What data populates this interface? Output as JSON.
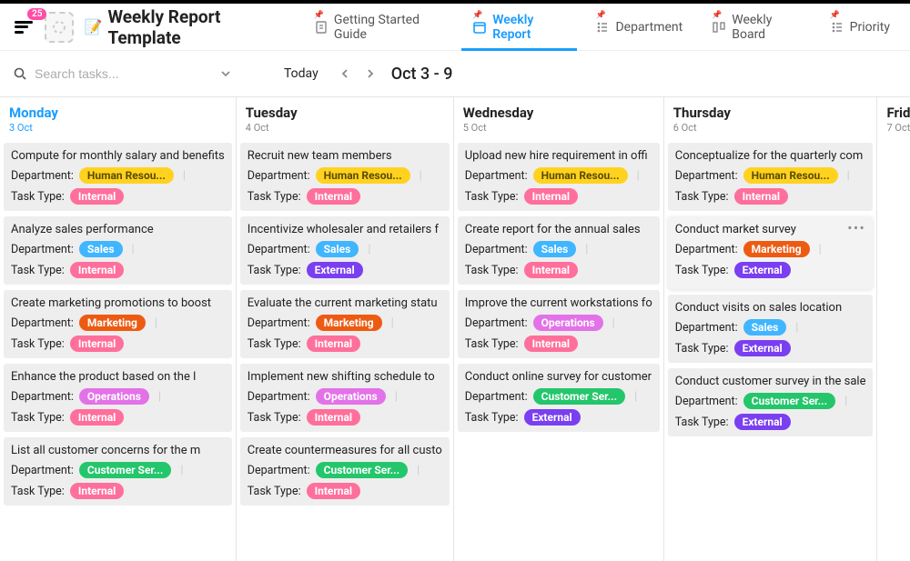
{
  "header": {
    "notification_count": "25",
    "page_emoji": "📝",
    "page_title": "Weekly Report Template"
  },
  "tabs": [
    {
      "label": "Getting Started Guide",
      "active": false
    },
    {
      "label": "Weekly Report",
      "active": true
    },
    {
      "label": "Department",
      "active": false
    },
    {
      "label": "Weekly Board",
      "active": false
    },
    {
      "label": "Priority",
      "active": false
    }
  ],
  "toolbar": {
    "search_placeholder": "Search tasks...",
    "today_label": "Today",
    "date_range": "Oct 3 - 9"
  },
  "field_labels": {
    "department": "Department:",
    "task_type": "Task Type:"
  },
  "tag_colors": {
    "Human Resou...": "#ffd21f",
    "Sales": "#3fb6ff",
    "Marketing": "#ed5b13",
    "Operations": "#e372e8",
    "Customer Ser...": "#24c66b",
    "Internal": "#ff6f9c",
    "External": "#7a3ff0"
  },
  "columns": [
    {
      "day": "Monday",
      "date": "3 Oct",
      "active": true,
      "cards": [
        {
          "title": "Compute for monthly salary and benefits",
          "department": "Human Resou...",
          "task_type": "Internal"
        },
        {
          "title": "Analyze sales performance",
          "department": "Sales",
          "task_type": "Internal"
        },
        {
          "title": "Create marketing promotions to boost",
          "department": "Marketing",
          "task_type": "Internal"
        },
        {
          "title": "Enhance the product based on the l",
          "department": "Operations",
          "task_type": "Internal"
        },
        {
          "title": "List all customer concerns for the m",
          "department": "Customer Ser...",
          "task_type": "Internal"
        }
      ]
    },
    {
      "day": "Tuesday",
      "date": "4 Oct",
      "active": false,
      "cards": [
        {
          "title": "Recruit new team members",
          "department": "Human Resou...",
          "task_type": "Internal"
        },
        {
          "title": "Incentivize wholesaler and retailers f",
          "department": "Sales",
          "task_type": "External"
        },
        {
          "title": "Evaluate the current marketing statu",
          "department": "Marketing",
          "task_type": "Internal"
        },
        {
          "title": "Implement new shifting schedule to",
          "department": "Operations",
          "task_type": "Internal"
        },
        {
          "title": "Create countermeasures for all custo",
          "department": "Customer Ser...",
          "task_type": "Internal"
        }
      ]
    },
    {
      "day": "Wednesday",
      "date": "5 Oct",
      "active": false,
      "cards": [
        {
          "title": "Upload new hire requirement in offi",
          "department": "Human Resou...",
          "task_type": "Internal"
        },
        {
          "title": "Create report for the annual sales",
          "department": "Sales",
          "task_type": "Internal"
        },
        {
          "title": "Improve the current workstations fo",
          "department": "Operations",
          "task_type": "Internal"
        },
        {
          "title": "Conduct online survey for customer",
          "department": "Customer Ser...",
          "task_type": "External"
        }
      ]
    },
    {
      "day": "Thursday",
      "date": "6 Oct",
      "active": false,
      "cards": [
        {
          "title": "Conceptualize for the quarterly com",
          "department": "Human Resou...",
          "task_type": "Internal"
        },
        {
          "title": "Conduct market survey",
          "department": "Marketing",
          "task_type": "External",
          "hover": true
        },
        {
          "title": "Conduct visits on sales location",
          "department": "Sales",
          "task_type": "External"
        },
        {
          "title": "Conduct customer survey in the sale",
          "department": "Customer Ser...",
          "task_type": "External"
        }
      ]
    },
    {
      "day": "Friday",
      "date": "7 Oct",
      "active": false,
      "cards": []
    }
  ]
}
